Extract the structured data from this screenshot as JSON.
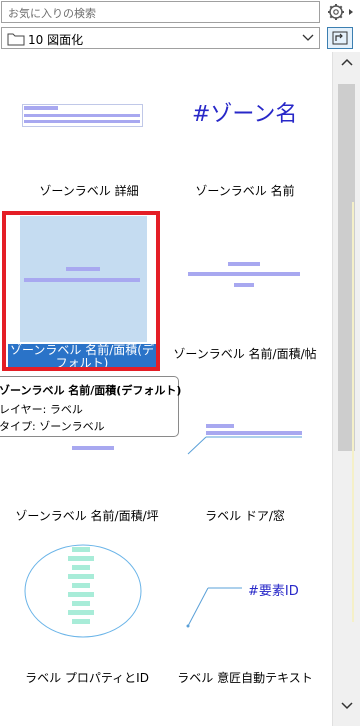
{
  "search": {
    "placeholder": "お気に入りの検索"
  },
  "folder": {
    "label": "10 図面化"
  },
  "items": [
    {
      "label": "ゾーンラベル 詳細"
    },
    {
      "label": "ゾーンラベル 名前",
      "preview_text": "#ゾーン名"
    },
    {
      "label": "ゾーンラベル 名前/面積(デフォルト)",
      "selected": true
    },
    {
      "label": "ゾーンラベル 名前/面積/帖"
    },
    {
      "label": "ゾーンラベル 名前/面積/坪"
    },
    {
      "label": "ラベル ドア/窓"
    },
    {
      "label": "ラベル プロパティとID"
    },
    {
      "label": "ラベル 意匠自動テキスト",
      "preview_text": "#要素ID"
    }
  ],
  "tooltip": {
    "title": "ゾーンラベル 名前/面積(デフォルト)",
    "layer": "レイヤー: ラベル",
    "type": "タイプ: ゾーンラベル"
  },
  "colors": {
    "selection_frame": "#e41e26",
    "selection_label_bg": "#2a73c8",
    "selection_fill": "#c5dcf1",
    "preview_bar": "#a8a8f0",
    "preview_text": "#2828c8",
    "property_bar": "#a8ecd8"
  }
}
